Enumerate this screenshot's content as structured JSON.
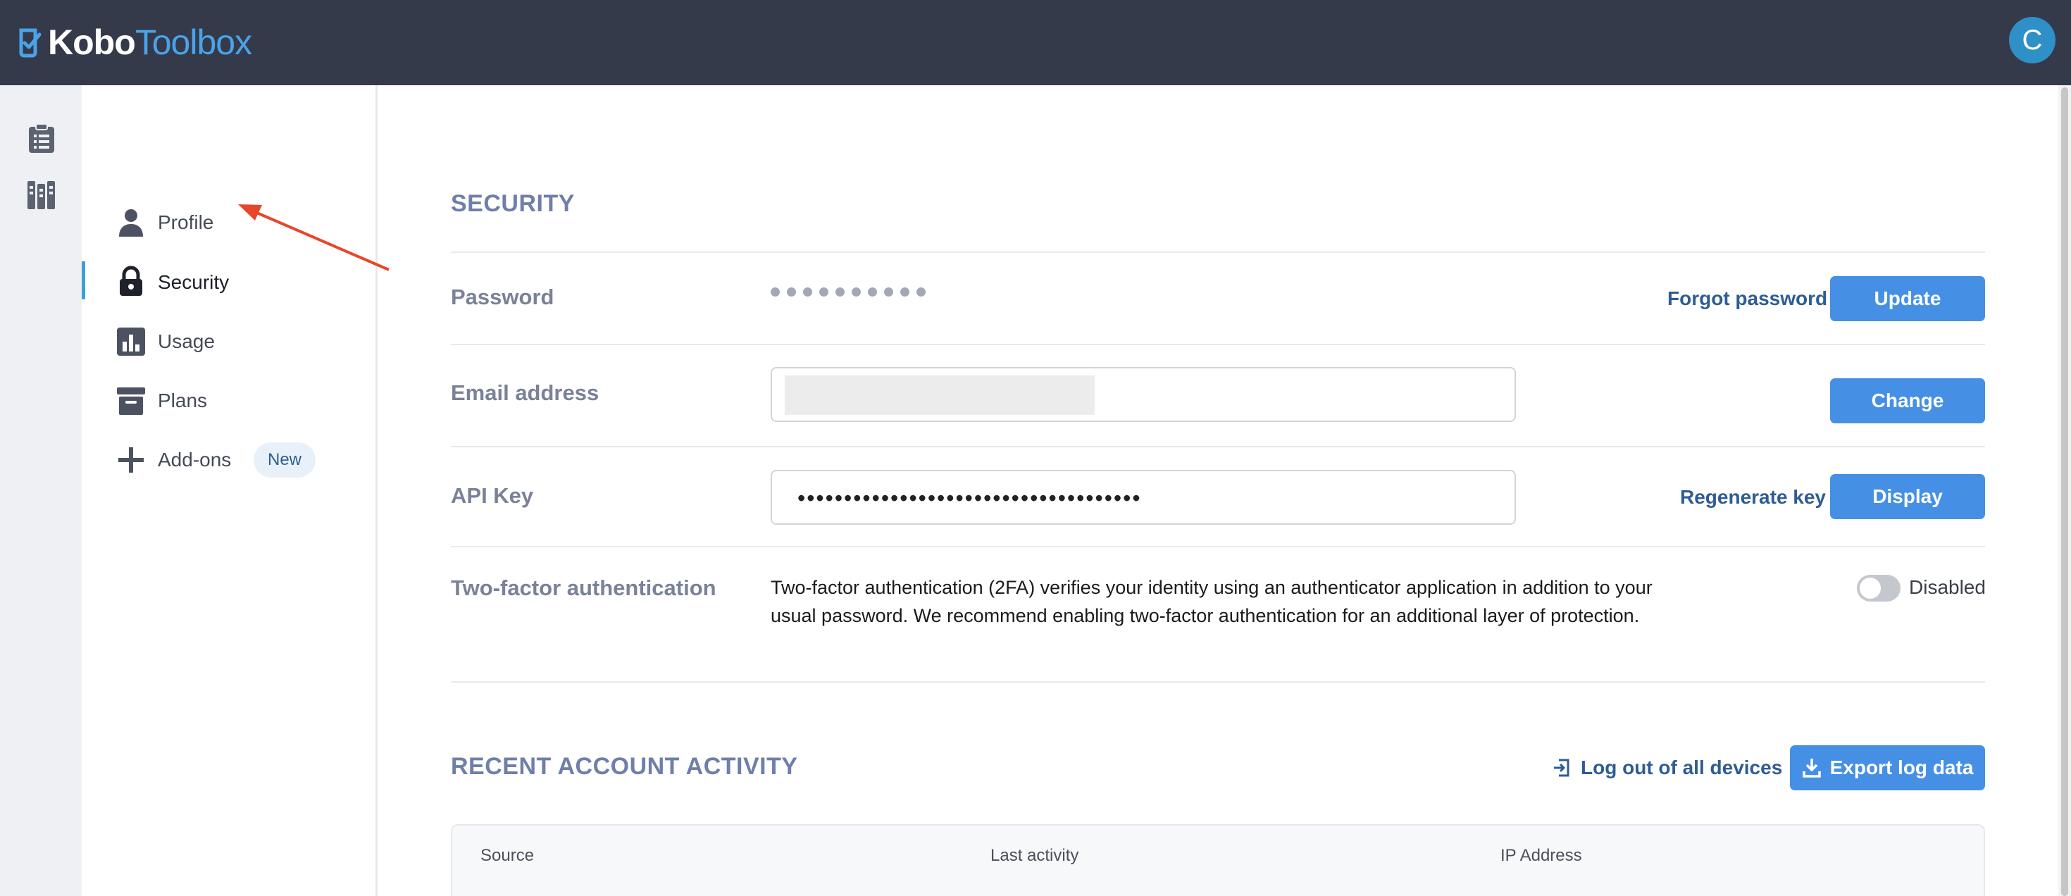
{
  "app": {
    "logo_part1": "Kobo",
    "logo_part2": "Toolbox",
    "avatar_initial": "C",
    "brand_color": "#4aa3e8",
    "header_bg": "#343a4a"
  },
  "rail": {
    "items": [
      {
        "icon": "clipboard-list-icon"
      },
      {
        "icon": "library-books-icon"
      }
    ]
  },
  "subnav": {
    "items": [
      {
        "label": "Profile",
        "icon": "user-icon",
        "active": false
      },
      {
        "label": "Security",
        "icon": "lock-icon",
        "active": true
      },
      {
        "label": "Usage",
        "icon": "bar-chart-icon",
        "active": false
      },
      {
        "label": "Plans",
        "icon": "archive-icon",
        "active": false
      },
      {
        "label": "Add-ons",
        "icon": "plus-icon",
        "active": false,
        "badge": "New"
      }
    ],
    "active_color": "#3ca0d6"
  },
  "security": {
    "title": "SECURITY",
    "password": {
      "label": "Password",
      "forgot_link": "Forgot password",
      "update_button": "Update"
    },
    "email": {
      "label": "Email address",
      "change_button": "Change"
    },
    "api_key": {
      "label": "API Key",
      "value": "•••••••••••••••••••••••••••••••••••••",
      "regenerate_link": "Regenerate key",
      "display_button": "Display"
    },
    "two_factor": {
      "label": "Two-factor authentication",
      "description": "Two-factor authentication (2FA) verifies your identity using an authenticator application in addition to your usual password. We recommend enabling two-factor authentication for an additional layer of protection.",
      "status": "Disabled",
      "enabled": false
    }
  },
  "activity": {
    "title": "RECENT ACCOUNT ACTIVITY",
    "logout_link": "Log out of all devices",
    "export_button": "Export log data",
    "columns": [
      "Source",
      "Last activity",
      "IP Address"
    ]
  },
  "colors": {
    "button": "#4590e5",
    "link": "#2e5c94",
    "section_title": "#6e7fa9",
    "annotation_arrow": "#e8462a"
  }
}
